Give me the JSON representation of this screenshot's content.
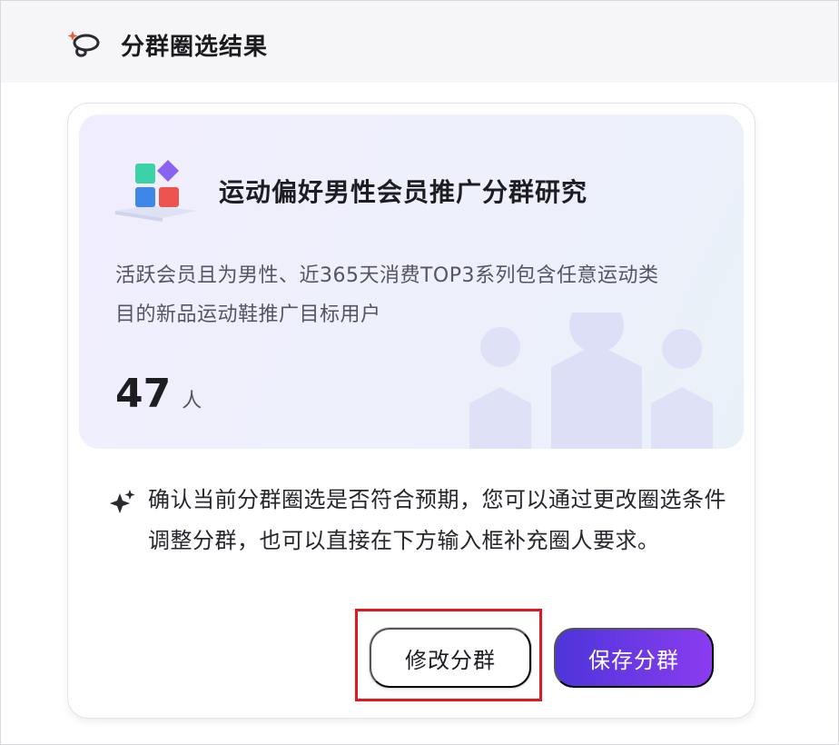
{
  "header": {
    "title": "分群圈选结果",
    "icon": "lasso-sparkle-icon"
  },
  "segment": {
    "icon": "blocks-icon",
    "name": "运动偏好男性会员推广分群研究",
    "description": "活跃会员且为男性、近365天消费TOP3系列包含任意运动类目的新品运动鞋推广目标用户",
    "count": "47",
    "count_unit": "人"
  },
  "note": {
    "icon": "sparkle-icon",
    "text": "确认当前分群圈选是否符合预期，您可以通过更改圈选条件调整分群，也可以直接在下方输入框补充圈人要求。"
  },
  "actions": {
    "modify_label": "修改分群",
    "save_label": "保存分群"
  },
  "colors": {
    "accent_start": "#4d35d9",
    "accent_end": "#8a3cf0",
    "highlight": "#e0191e"
  }
}
